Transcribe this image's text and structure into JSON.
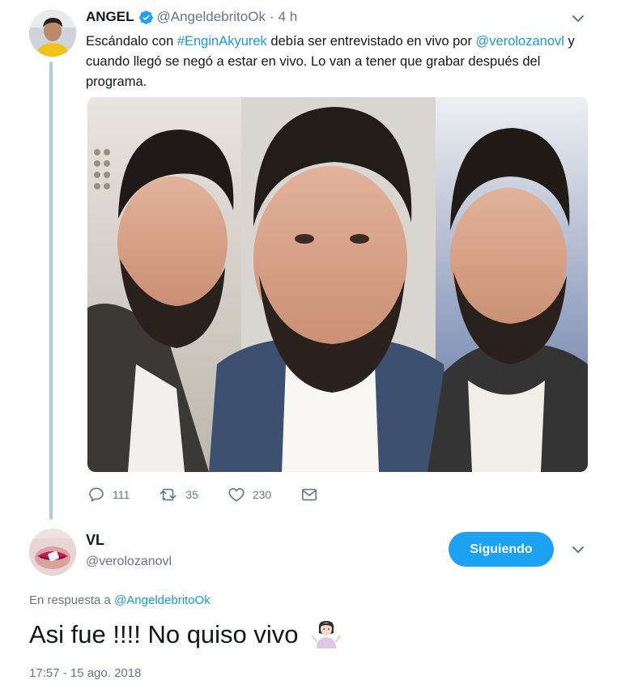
{
  "tweet": {
    "author_name": "ANGEL",
    "author_handle": "@AngeldebritoOk",
    "separator": "·",
    "time_ago": "4 h",
    "text": {
      "part1": "Escándalo con ",
      "hashtag": "#EnginAkyurek",
      "part2": " debía ser entrevistado en vivo por ",
      "mention": "@verolozanovl",
      "part3": " y cuando llegó se negó a estar en vivo. Lo van a tener que grabar después del programa."
    },
    "reply_count": "111",
    "retweet_count": "35",
    "like_count": "230"
  },
  "reply": {
    "author_name": "VL",
    "author_handle": "@verolozanovl",
    "follow_label": "Siguiendo",
    "in_reply_prefix": "En respuesta a ",
    "in_reply_handle": "@AngeldebritoOk",
    "text": "Asi fue !!!! No quiso vivo",
    "timestamp": "17:57 - 15 ago. 2018"
  },
  "colors": {
    "accent": "#1da1f2",
    "link": "#1b95e0",
    "muted": "#657786",
    "thread_line": "#a7cde8"
  },
  "icons": [
    "verified-badge-icon",
    "chevron-down-icon",
    "reply-icon",
    "retweet-icon",
    "like-icon",
    "direct-message-icon",
    "person-shrugging-emoji"
  ]
}
